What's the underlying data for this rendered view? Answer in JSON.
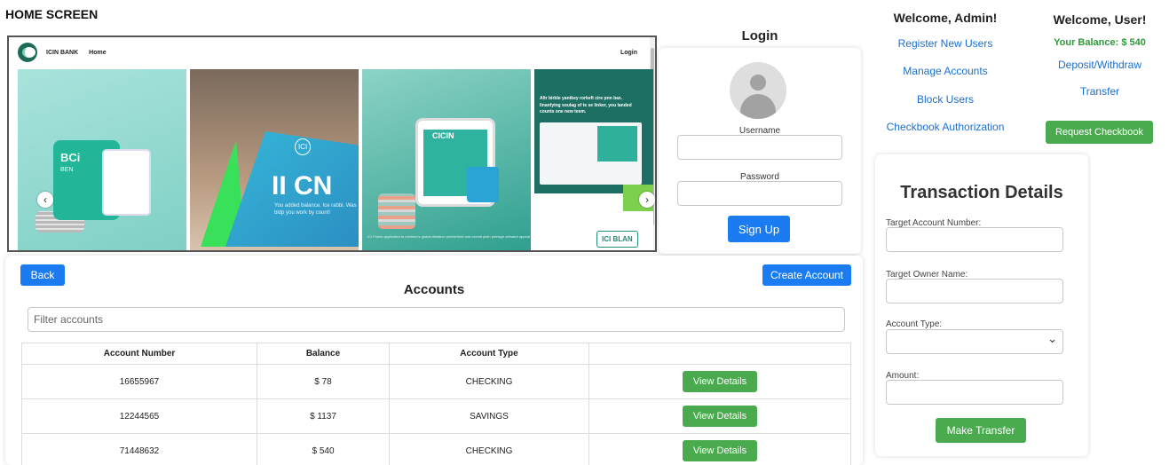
{
  "page_label": "HOME SCREEN",
  "home": {
    "brand": "ICIN BANK",
    "nav_home": "Home",
    "nav_login": "Login",
    "slides": [
      {
        "title": "BCi",
        "subtitle": "BEN"
      },
      {
        "title": "II CN",
        "logo": "ICI",
        "small": "You added balance. Ice rabbi. Was bldp you work by count!"
      },
      {
        "title": "CICIN",
        "caption": "ICI Points applicated to member's global dituation points/fund and oversit plain poinage cellsand appeal"
      },
      {
        "title": "Altr birble yantkey rorkeft cire pnn bax. linanfying soulag of te se linker, you landed counts one new teem.",
        "badge": "ICI BLAN"
      }
    ]
  },
  "login": {
    "title": "Login",
    "username_label": "Username",
    "password_label": "Password",
    "signup_label": "Sign Up"
  },
  "admin": {
    "heading": "Welcome, Admin!",
    "links": [
      "Register New Users",
      "Manage Accounts",
      "Block Users",
      "Checkbook Authorization"
    ]
  },
  "user": {
    "heading": "Welcome, User!",
    "balance": "Your Balance: $ 540",
    "links": [
      "Deposit/Withdraw",
      "Transfer"
    ],
    "checkbook_button": "Request Checkbook"
  },
  "transaction": {
    "title": "Transaction Details",
    "target_account_label": "Target Account Number:",
    "target_owner_label": "Target Owner Name:",
    "account_type_label": "Account Type:",
    "amount_label": "Amount:",
    "submit_label": "Make Transfer"
  },
  "accounts": {
    "back_label": "Back",
    "create_label": "Create Account",
    "title": "Accounts",
    "filter_placeholder": "Filter accounts",
    "columns": [
      "Account Number",
      "Balance",
      "Account Type",
      ""
    ],
    "rows": [
      {
        "number": "16655967",
        "balance": "$ 78",
        "type": "CHECKING",
        "action": "View Details"
      },
      {
        "number": "12244565",
        "balance": "$ 1137",
        "type": "SAVINGS",
        "action": "View Details"
      },
      {
        "number": "71448632",
        "balance": "$ 540",
        "type": "CHECKING",
        "action": "View Details"
      }
    ]
  }
}
